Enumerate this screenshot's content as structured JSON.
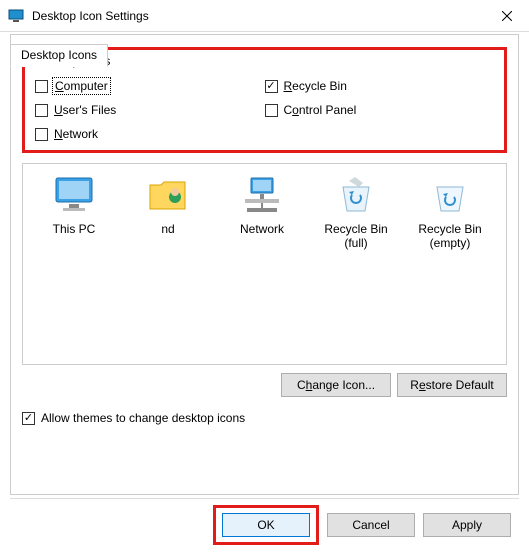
{
  "window": {
    "title": "Desktop Icon Settings"
  },
  "tab": {
    "label": "Desktop Icons"
  },
  "group": {
    "title": "Desktop icons",
    "items": {
      "computer": {
        "label": "Computer",
        "accel": "C",
        "checked": false
      },
      "usersfiles": {
        "label": "User's Files",
        "accel": "U",
        "checked": false
      },
      "network": {
        "label": "Network",
        "accel": "N",
        "checked": false
      },
      "recyclebin": {
        "label": "Recycle Bin",
        "accel": "R",
        "checked": true
      },
      "controlpanel": {
        "label": "Control Panel",
        "accel": "o",
        "checked": false
      }
    }
  },
  "preview": {
    "thispc": {
      "caption": "This PC"
    },
    "user": {
      "caption": "nd"
    },
    "network": {
      "caption": "Network"
    },
    "rbfull": {
      "caption": "Recycle Bin (full)"
    },
    "rbempty": {
      "caption": "Recycle Bin (empty)"
    }
  },
  "buttons": {
    "changeicon": "Change Icon...",
    "restore": "Restore Default"
  },
  "allow": {
    "label": "Allow themes to change desktop icons",
    "checked": true
  },
  "footer": {
    "ok": "OK",
    "cancel": "Cancel",
    "apply": "Apply"
  }
}
